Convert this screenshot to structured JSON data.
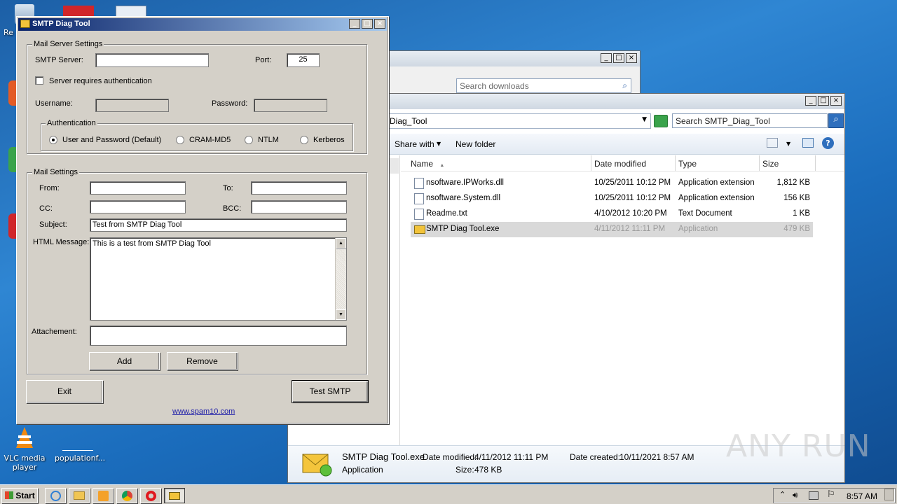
{
  "desktop": {
    "icons": [
      {
        "label": "Re",
        "kind": "recycle-bin"
      },
      {
        "label": "VLC media player",
        "kind": "vlc"
      },
      {
        "label": "populationf...",
        "kind": "file"
      }
    ]
  },
  "downloads_window": {
    "search_placeholder": "Search downloads"
  },
  "explorer": {
    "path_fragment": "Diag_Tool",
    "search_placeholder": "Search SMTP_Diag_Tool",
    "toolbar": {
      "share_with": "Share with",
      "new_folder": "New folder"
    },
    "columns": {
      "name": "Name",
      "date": "Date modified",
      "type": "Type",
      "size": "Size"
    },
    "files": [
      {
        "name": "nsoftware.IPWorks.dll",
        "date": "10/25/2011 10:12 PM",
        "type": "Application extension",
        "size": "1,812 KB"
      },
      {
        "name": "nsoftware.System.dll",
        "date": "10/25/2011 10:12 PM",
        "type": "Application extension",
        "size": "156 KB"
      },
      {
        "name": "Readme.txt",
        "date": "4/10/2012 10:20 PM",
        "type": "Text Document",
        "size": "1 KB"
      },
      {
        "name": "SMTP Diag Tool.exe",
        "date": "4/11/2012 11:11 PM",
        "type": "Application",
        "size": "479 KB"
      }
    ],
    "details": {
      "name": "SMTP Diag Tool.exe",
      "kind": "Application",
      "date_modified_label": "Date modified:",
      "date_modified": "4/11/2012 11:11 PM",
      "size_label": "Size:",
      "size": "478 KB",
      "date_created_label": "Date created:",
      "date_created": "10/11/2021 8:57 AM"
    }
  },
  "dialog": {
    "title": "SMTP Diag Tool",
    "server_group": "Mail Server Settings",
    "smtp_server_label": "SMTP Server:",
    "smtp_server_value": "",
    "port_label": "Port:",
    "port_value": "25",
    "auth_check_label": "Server requires authentication",
    "username_label": "Username:",
    "password_label": "Password:",
    "auth_group": "Authentication",
    "auth_options": [
      "User and Password (Default)",
      "CRAM-MD5",
      "NTLM",
      "Kerberos"
    ],
    "mail_group": "Mail Settings",
    "from_label": "From:",
    "to_label": "To:",
    "cc_label": "CC:",
    "bcc_label": "BCC:",
    "subject_label": "Subject:",
    "subject_value": "Test from SMTP Diag Tool",
    "html_label": "HTML Message:",
    "html_value": "This is a test from SMTP Diag Tool",
    "attach_label": "Attachement:",
    "add_button": "Add",
    "remove_button": "Remove",
    "exit_button": "Exit",
    "test_button": "Test SMTP",
    "link": "www.spam10.com"
  },
  "taskbar": {
    "start_label": "Start",
    "clock": "8:57 AM"
  },
  "watermark": "ANY RUN"
}
